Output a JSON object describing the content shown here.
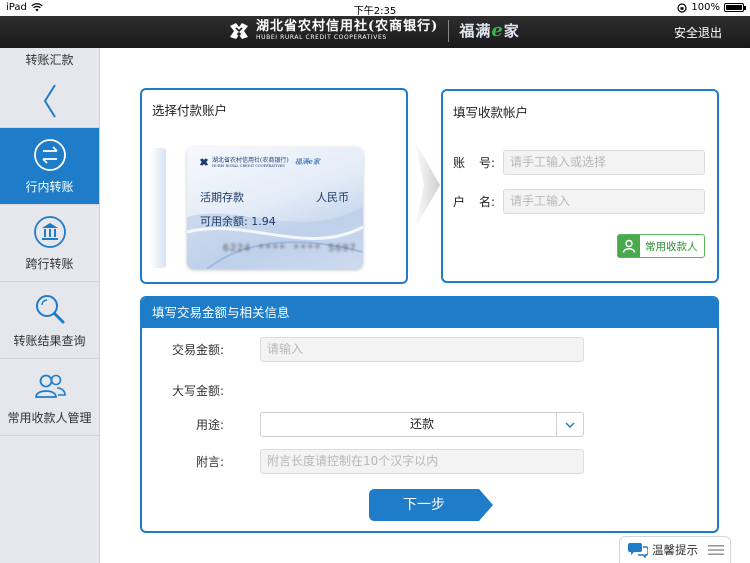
{
  "status_bar": {
    "device": "iPad",
    "time": "下午2:35",
    "battery": "100%"
  },
  "header": {
    "brand_cn": "湖北省农村信用社(农商银行)",
    "brand_en": "HUBEI RURAL CREDIT COOPERATIVES",
    "sub_brand_a": "福满",
    "sub_brand_e": "e",
    "sub_brand_b": "家",
    "logout": "安全退出"
  },
  "sidebar": {
    "title": "转账汇款",
    "items": [
      {
        "label": "行内转账",
        "icon": "transfer-arrows-icon",
        "active": true
      },
      {
        "label": "跨行转账",
        "icon": "bank-building-icon",
        "active": false
      },
      {
        "label": "转账结果查询",
        "icon": "search-icon",
        "active": false
      },
      {
        "label": "常用收款人管理",
        "icon": "contacts-icon",
        "active": false
      }
    ]
  },
  "payer": {
    "title": "选择付款账户",
    "card": {
      "bank_name": "湖北省农村信用社(农商银行)",
      "bank_name_en": "HUBEI RURAL CREDIT COOPERATIVES",
      "brand": "福满e家",
      "type": "活期存款",
      "currency": "人民币",
      "balance_label": "可用余额:",
      "balance": "1.94",
      "number_masked": "6224 **** **** 5697"
    }
  },
  "payee": {
    "title": "填写收款帐户",
    "account_label_a": "账",
    "account_label_b": "号:",
    "account_placeholder": "请手工输入或选择",
    "name_label_a": "户",
    "name_label_b": "名:",
    "name_placeholder": "请手工输入",
    "favorites_button": "常用收款人"
  },
  "details": {
    "title": "填写交易金额与相关信息",
    "amount_label": "交易金额:",
    "amount_placeholder": "请输入",
    "amount_upper_label": "大写金额:",
    "purpose_label": "用途:",
    "purpose_value": "还款",
    "note_label": "附言:",
    "note_placeholder": "附言长度请控制在10个汉字以内",
    "next_button": "下一步"
  },
  "tip": {
    "label": "温馨提示"
  },
  "colors": {
    "primary": "#1e7cc8",
    "green": "#4aa84d",
    "header": "#222222",
    "sidebar_bg": "#e6e7ec"
  }
}
